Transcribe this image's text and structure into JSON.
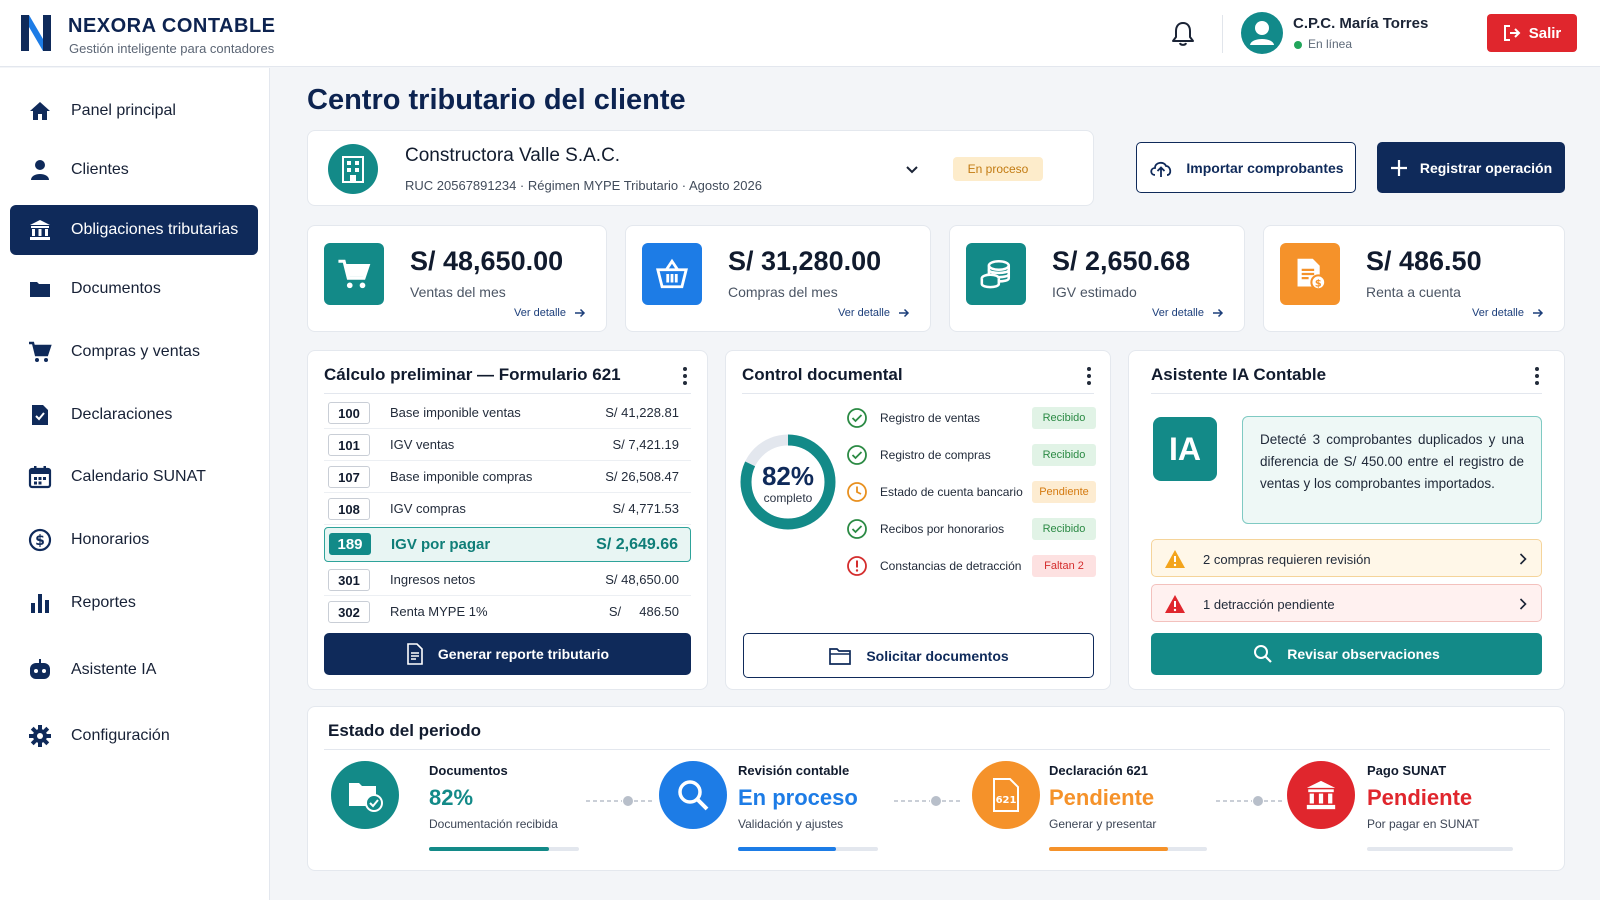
{
  "header": {
    "brand": "NEXORA CONTABLE",
    "tagline": "Gestión inteligente para contadores",
    "user_name": "C.P.C. María Torres",
    "user_status": "En línea",
    "logout_label": "Salir"
  },
  "sidebar": {
    "items": [
      {
        "label": "Panel principal",
        "icon": "home-icon"
      },
      {
        "label": "Clientes",
        "icon": "user-icon"
      },
      {
        "label": "Obligaciones tributarias",
        "icon": "bank-icon",
        "active": true
      },
      {
        "label": "Documentos",
        "icon": "folder-icon"
      },
      {
        "label": "Compras y ventas",
        "icon": "cart-icon"
      },
      {
        "label": "Declaraciones",
        "icon": "document-check-icon"
      },
      {
        "label": "Calendario SUNAT",
        "icon": "calendar-icon"
      },
      {
        "label": "Honorarios",
        "icon": "dollar-circle-icon"
      },
      {
        "label": "Reportes",
        "icon": "bar-chart-icon"
      },
      {
        "label": "Asistente IA",
        "icon": "robot-icon"
      },
      {
        "label": "Configuración",
        "icon": "gear-icon"
      }
    ]
  },
  "main": {
    "title": "Centro tributario del cliente",
    "client": {
      "name": "Constructora Valle S.A.C.",
      "meta": "RUC  20567891234  ·  Régimen MYPE Tributario  ·  Agosto 2026",
      "status": "En proceso"
    },
    "import_label": "Importar comprobantes",
    "register_label": "Registrar operación"
  },
  "kpis": [
    {
      "value": "S/ 48,650.00",
      "label": "Ventas del mes",
      "link": "Ver detalle",
      "color": "#138a88",
      "icon": "cart-icon"
    },
    {
      "value": "S/ 31,280.00",
      "label": "Compras del mes",
      "link": "Ver detalle",
      "color": "#1d7ce6",
      "icon": "basket-icon"
    },
    {
      "value": "S/ 2,650.68",
      "label": "IGV estimado",
      "link": "Ver detalle",
      "color": "#138a88",
      "icon": "coins-icon"
    },
    {
      "value": "S/ 486.50",
      "label": "Renta a cuenta",
      "link": "Ver detalle",
      "color": "#f5922a",
      "icon": "invoice-icon"
    }
  ],
  "form621": {
    "title": "Cálculo preliminar — Formulario 621",
    "rows": [
      {
        "code": "100",
        "label": "Base imponible ventas",
        "amount": "S/ 41,228.81"
      },
      {
        "code": "101",
        "label": "IGV ventas",
        "amount": "S/  7,421.19"
      },
      {
        "code": "107",
        "label": "Base imponible compras",
        "amount": "S/ 26,508.47"
      },
      {
        "code": "108",
        "label": "IGV compras",
        "amount": "S/  4,771.53"
      },
      {
        "code": "189",
        "label": "IGV por pagar",
        "amount": "S/ 2,649.66",
        "highlight": true
      },
      {
        "code": "301",
        "label": "Ingresos netos",
        "amount": "S/  48,650.00"
      },
      {
        "code": "302",
        "label": "Renta MYPE 1%",
        "amount": "S/     486.50"
      }
    ],
    "button": "Generar reporte tributario"
  },
  "control": {
    "title": "Control documental",
    "percent_label": "82%",
    "percent": 82,
    "sub": "completo",
    "items": [
      {
        "label": "Registro de ventas",
        "status": "Recibido",
        "kind": "ok"
      },
      {
        "label": "Registro de compras",
        "status": "Recibido",
        "kind": "ok"
      },
      {
        "label": "Estado de cuenta bancario",
        "status": "Pendiente",
        "kind": "warn"
      },
      {
        "label": "Recibos por honorarios",
        "status": "Recibido",
        "kind": "ok"
      },
      {
        "label": "Constancias de detracción",
        "status": "Faltan 2",
        "kind": "err"
      }
    ],
    "button": "Solicitar documentos"
  },
  "ia": {
    "title": "Asistente IA Contable",
    "logo": "IA",
    "message": "Detecté 3 comprobantes duplicados y una diferencia de S/ 450.00 entre el registro de ventas y los comprobantes importados.",
    "alerts": [
      {
        "label": "2 compras requieren revisión",
        "kind": "warn"
      },
      {
        "label": "1 detracción pendiente",
        "kind": "err"
      }
    ],
    "button": "Revisar observaciones"
  },
  "period": {
    "title": "Estado del periodo",
    "steps": [
      {
        "title": "Documentos",
        "value": "82%",
        "sub": "Documentación recibida",
        "progress": 0.8,
        "color": "#138a88"
      },
      {
        "title": "Revisión contable",
        "value": "En proceso",
        "sub": "Validación y ajustes",
        "progress": 0.7,
        "color": "#1d7ce6"
      },
      {
        "title": "Declaración 621",
        "value": "Pendiente",
        "sub": "Generar y presentar",
        "progress": 0.75,
        "color": "#f5922a",
        "icon_text": "621"
      },
      {
        "title": "Pago SUNAT",
        "value": "Pendiente",
        "sub": "Por pagar en SUNAT",
        "progress": 0.0,
        "color": "#e0262d"
      }
    ]
  }
}
